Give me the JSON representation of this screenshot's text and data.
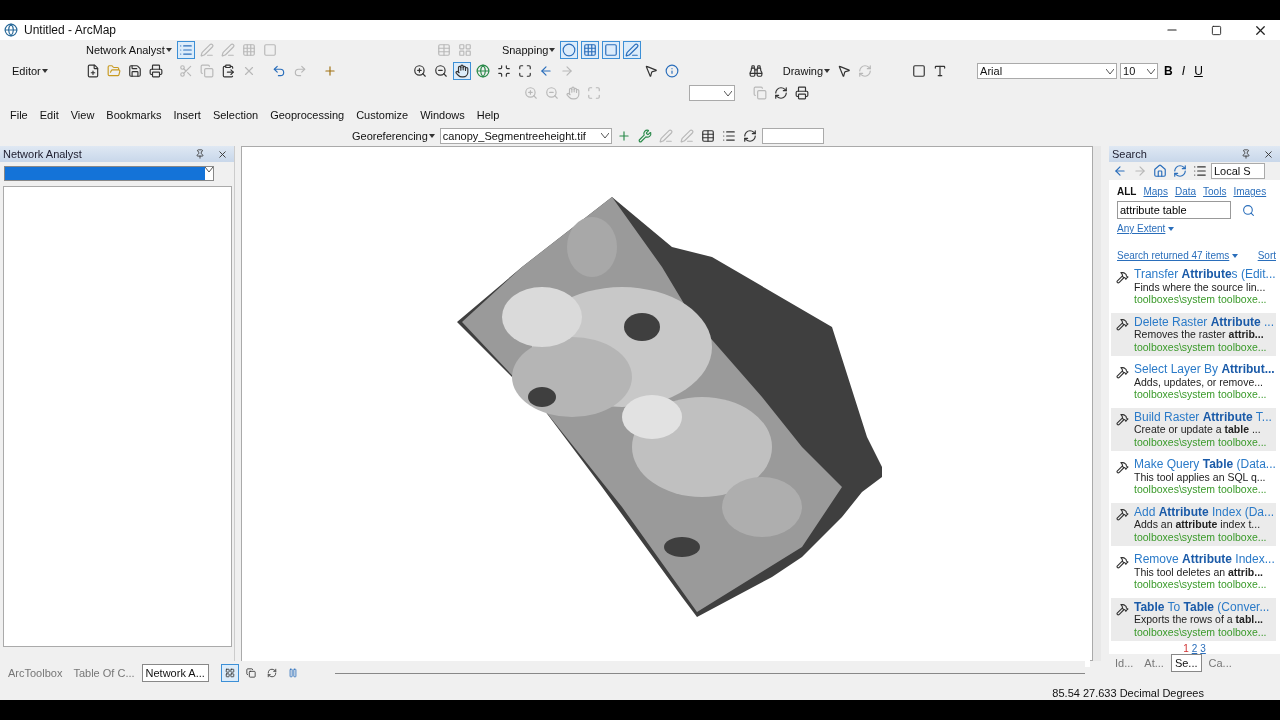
{
  "window": {
    "title": "Untitled - ArcMap"
  },
  "toolbars": {
    "network_analyst": "Network Analyst",
    "snapping": "Snapping",
    "editor": "Editor",
    "drawing": "Drawing",
    "font": "Arial",
    "font_size": "10",
    "bold": "B",
    "italic": "I",
    "underline": "U",
    "georeferencing": "Georeferencing",
    "layer": "canopy_Segmentreeheight.tif"
  },
  "menu": [
    "File",
    "Edit",
    "View",
    "Bookmarks",
    "Insert",
    "Selection",
    "Geoprocessing",
    "Customize",
    "Windows",
    "Help"
  ],
  "left_panel": {
    "title": "Network Analyst"
  },
  "search_panel": {
    "title": "Search",
    "scope": "Local S",
    "filters": [
      {
        "label": "ALL",
        "selected": true
      },
      {
        "label": "Maps",
        "selected": false
      },
      {
        "label": "Data",
        "selected": false
      },
      {
        "label": "Tools",
        "selected": false
      },
      {
        "label": "Images",
        "selected": false
      }
    ],
    "query": "attribute table",
    "extent": "Any Extent",
    "summary": "Search returned 47 items",
    "sort": "Sort",
    "results": [
      {
        "title": "Transfer **Attribute**s (Edit...",
        "description": "Finds where the source lin...",
        "path": "toolboxes\\system toolboxe..."
      },
      {
        "title": "Delete Raster **Attribute** ...",
        "description": "Removes the raster **attrib...**",
        "path": "toolboxes\\system toolboxe..."
      },
      {
        "title": "Select Layer By **Attribut...**",
        "description": "Adds, updates, or remove...",
        "path": "toolboxes\\system toolboxe..."
      },
      {
        "title": "Build Raster **Attribute** T...",
        "description": "Create or update a **table** ...",
        "path": "toolboxes\\system toolboxe..."
      },
      {
        "title": "Make Query **Table** (Data...",
        "description": "This tool applies an SQL q...",
        "path": "toolboxes\\system toolboxe..."
      },
      {
        "title": "Add **Attribute** Index (Da...",
        "description": "Adds an **attribute** index t...",
        "path": "toolboxes\\system toolboxe..."
      },
      {
        "title": "Remove **Attribute** Index...",
        "description": "This tool deletes an **attrib...**",
        "path": "toolboxes\\system toolboxe..."
      },
      {
        "title": "**Table** To **Table** (Conver...",
        "description": "Exports the rows of a **tabl...**",
        "path": "toolboxes\\system toolboxe..."
      }
    ],
    "pages": [
      {
        "label": "1",
        "selected": true
      },
      {
        "label": "2",
        "selected": false
      },
      {
        "label": "3",
        "selected": false
      }
    ],
    "tabs": [
      {
        "label": "Id...",
        "selected": false
      },
      {
        "label": "At...",
        "selected": false
      },
      {
        "label": "Se...",
        "selected": true
      },
      {
        "label": "Ca...",
        "selected": false
      }
    ]
  },
  "dock_tabs": [
    {
      "label": "ArcToolbox",
      "selected": false
    },
    {
      "label": "Table Of C...",
      "selected": false
    },
    {
      "label": "Network A...",
      "selected": true
    }
  ],
  "status": {
    "coordinates": "85.54  27.633 Decimal Degrees"
  }
}
